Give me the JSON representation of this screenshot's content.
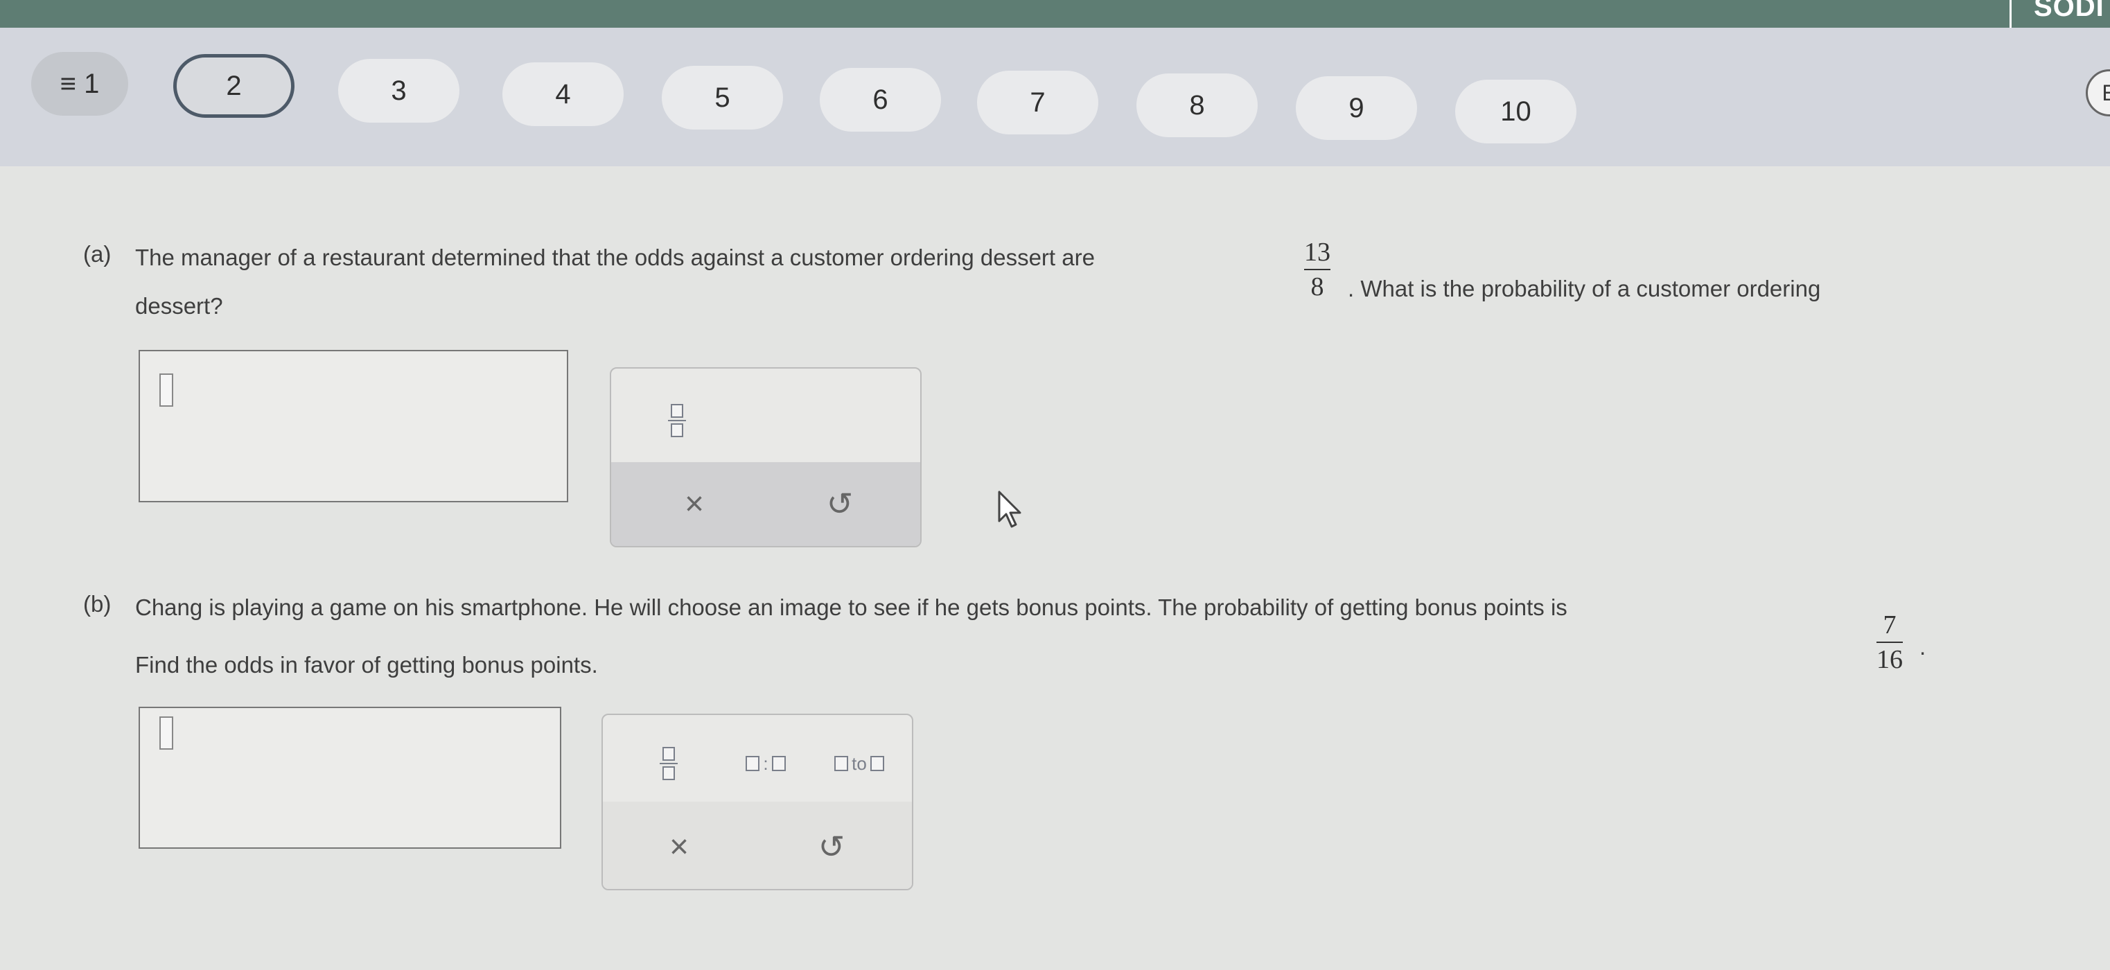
{
  "header": {
    "brand_text": "SODI",
    "right_circle_label": "E"
  },
  "question_nav": {
    "menu_label": "≡ 1",
    "items": [
      "2",
      "3",
      "4",
      "5",
      "6",
      "7",
      "8",
      "9",
      "10"
    ],
    "active": "2"
  },
  "part_a": {
    "label": "(a)",
    "text_before": "The manager of a restaurant determined that the odds against a customer ordering dessert are",
    "frac_num": "13",
    "frac_den": "8",
    "text_after": ". What is the probability of a customer ordering",
    "text_line2": "dessert?",
    "answer_value": "",
    "tools": {
      "fraction_icon": "fraction-template-icon",
      "clear_symbol": "×",
      "undo_symbol": "↺"
    }
  },
  "part_b": {
    "label": "(b)",
    "text_line1": "Chang is playing a game on his smartphone. He will choose an image to see if he gets bonus points. The probability of getting bonus points is",
    "frac_num": "7",
    "frac_den": "16",
    "text_line1_end": ".",
    "text_line2": "Find the odds in favor of getting bonus points.",
    "answer_value": "",
    "tools": {
      "ratio_sep": ":",
      "to_label": "to",
      "clear_symbol": "×",
      "undo_symbol": "↺"
    }
  }
}
